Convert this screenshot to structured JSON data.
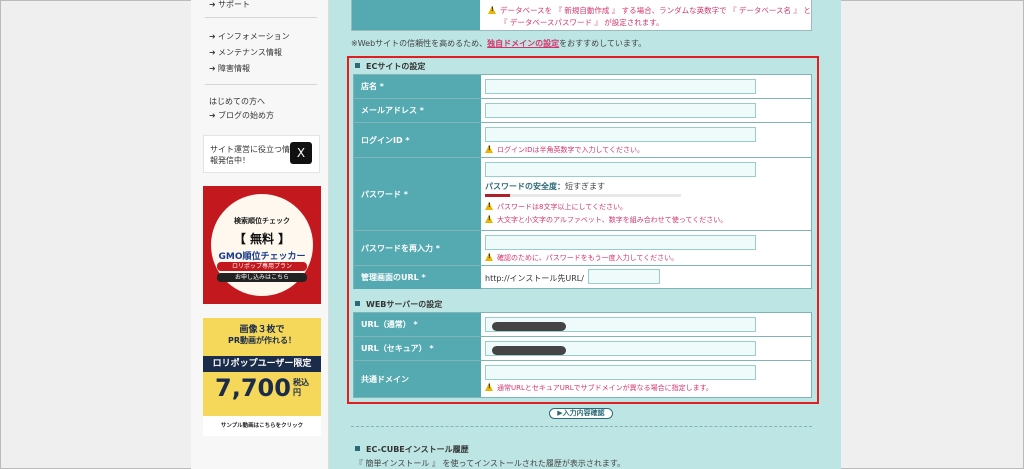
{
  "sidebar": {
    "top_links": [
      "サポート",
      "インフォメーション",
      "メンテナンス情報",
      "障害情報"
    ],
    "beginner_heading": "はじめての方へ",
    "blog_link": "ブログの始め方",
    "x_promo": {
      "text": "サイト運営に役立つ情報発信中！",
      "icon": "X"
    },
    "gmo_banner": {
      "line1": "検索順位チェック",
      "line2": "【 無料 】",
      "line3": "GMO順位チェッカー",
      "ribbon": "ロリポップ専用プラン",
      "cta": "お申し込みはこちら"
    },
    "video_banner": {
      "line1": "画像３枚で",
      "line2": "PR動画が作れる！",
      "line3": "ロリポップユーザー限定",
      "price": "7,700",
      "tax": "税込",
      "yen": "円",
      "footer": "サンプル動画はこちらをクリック"
    }
  },
  "db_notes": {
    "line1": "データベースを 『 新規自動作成 』 する場合、ランダムな英数字で 『 データベース名 』 と",
    "line2": "『 データベースパスワード 』 が設定されます。"
  },
  "domain_notice": {
    "prefix": "※Webサイトの信頼性を高めるため、",
    "link": "独自ドメインの設定",
    "suffix": "をおすすめしています。"
  },
  "ec_section": {
    "title": "ECサイトの設定",
    "store_name_label": "店名 *",
    "email_label": "メールアドレス *",
    "login_id_label": "ログインID *",
    "login_id_hint": "ログインIDは半角英数字で入力してください。",
    "password_label": "パスワード *",
    "strength_label": "パスワードの安全度：",
    "strength_value": "短すぎます",
    "strength_fraction": 0.13,
    "password_hint1": "パスワードは8文字以上にしてください。",
    "password_hint2": "大文字と小文字のアルファベット、数字を組み合わせて使ってください。",
    "password_confirm_label": "パスワードを再入力 *",
    "password_confirm_hint": "確認のために、パスワードをもう一度入力してください。",
    "admin_url_label": "管理画面のURL *",
    "admin_url_prefix": "http://インストール先URL/"
  },
  "web_section": {
    "title": "WEBサーバーの設定",
    "url_label": "URL（通常） *",
    "url_secure_label": "URL（セキュア） *",
    "shared_domain_label": "共通ドメイン",
    "shared_domain_hint": "通常URLとセキュアURLでサブドメインが異なる場合に指定します。"
  },
  "confirm_button": "入力内容確認",
  "history_section": {
    "title": "EC-CUBEインストール履歴",
    "note": "『 簡単インストール 』 を使ってインストールされた履歴が表示されます。"
  },
  "colors": {
    "background": "#bde5e3",
    "label_cell": "#55a9b1",
    "hint_text": "#d6336c",
    "highlight_border": "#e02020"
  }
}
